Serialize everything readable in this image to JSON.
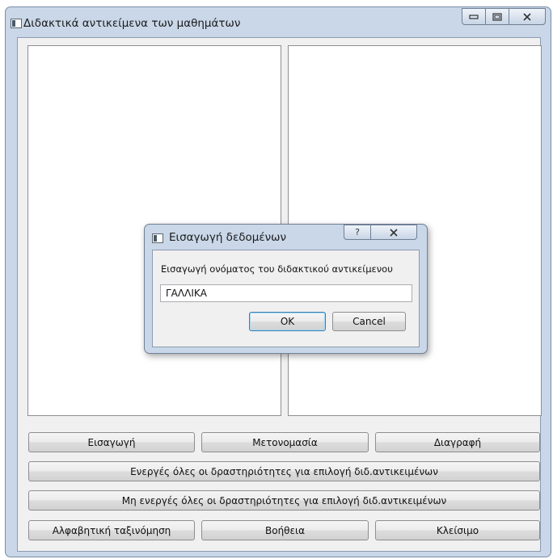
{
  "window": {
    "title": "Διδακτικά αντικείμενα των μαθημάτων",
    "caption_buttons": [
      "minimize-icon",
      "maximize-icon",
      "close-icon"
    ]
  },
  "buttons": {
    "insert": "Εισαγωγή",
    "rename": "Μετονομασία",
    "delete": "Διαγραφή",
    "enable_all": "Ενεργές όλες οι δραστηριότητες για επιλογή διδ.αντικειμένων",
    "disable_all": "Μη ενεργές όλες  οι δραστηριότητες για επιλογή διδ.αντικειμένων",
    "sort": "Αλφαβητική ταξινόμηση",
    "help": "Βοήθεια",
    "close": "Κλείσιμο"
  },
  "dialog": {
    "title": "Εισαγωγή δεδομένων",
    "label": "Εισαγωγή ονόματος του διδακτικού αντικείμενου",
    "input_value": "ΓΑΛΛΙΚΑ",
    "ok": "OK",
    "cancel": "Cancel",
    "help_glyph": "?"
  }
}
